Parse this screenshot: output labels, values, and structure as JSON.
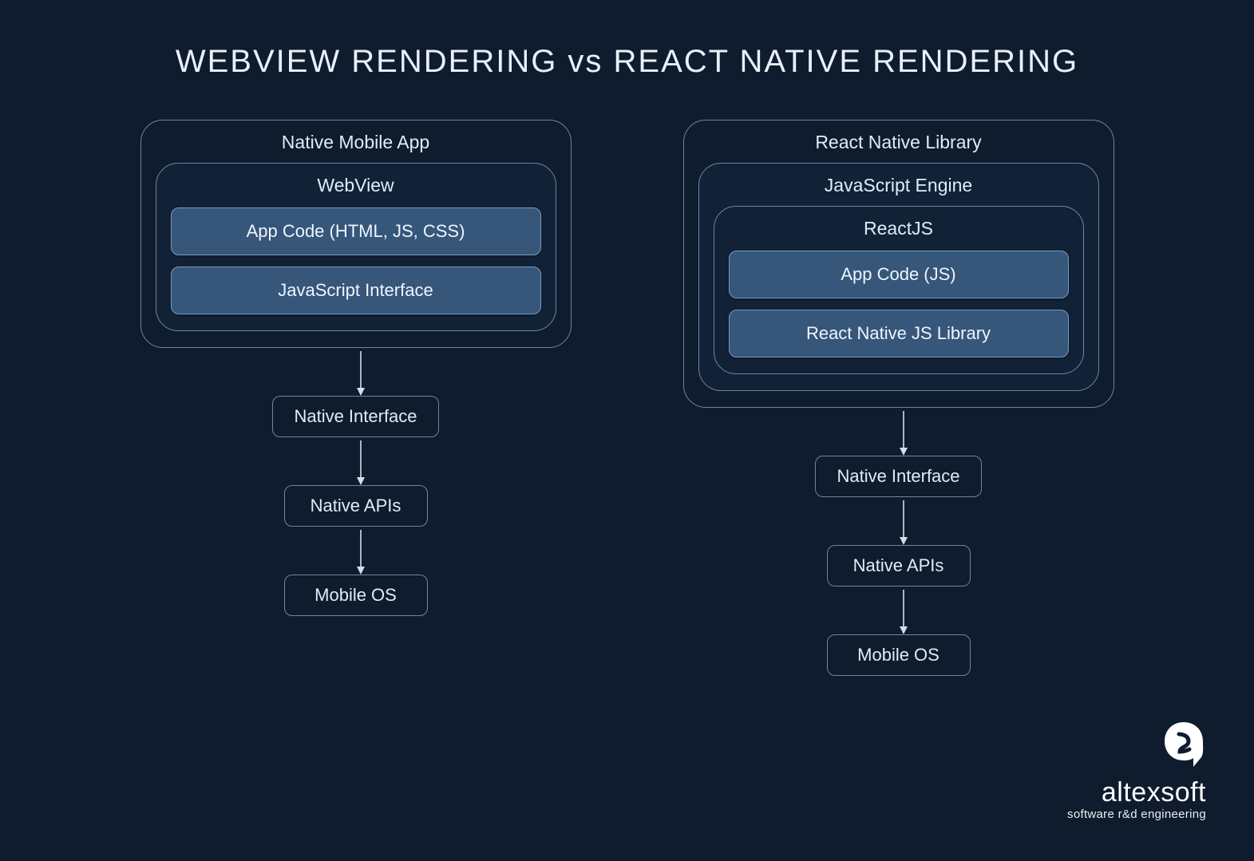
{
  "title": "WEBVIEW RENDERING vs REACT NATIVE RENDERING",
  "left": {
    "outer": "Native Mobile App",
    "inner": "WebView",
    "fills": [
      "App Code (HTML, JS, CSS)",
      "JavaScript Interface"
    ],
    "chain": [
      "Native Interface",
      "Native APIs",
      "Mobile OS"
    ]
  },
  "right": {
    "outer": "React Native Library",
    "mid": "JavaScript Engine",
    "inner": "ReactJS",
    "fills": [
      "App Code (JS)",
      "React Native JS Library"
    ],
    "chain": [
      "Native Interface",
      "Native APIs",
      "Mobile OS"
    ]
  },
  "brand": {
    "name": "altexsoft",
    "tag": "software r&d engineering"
  }
}
